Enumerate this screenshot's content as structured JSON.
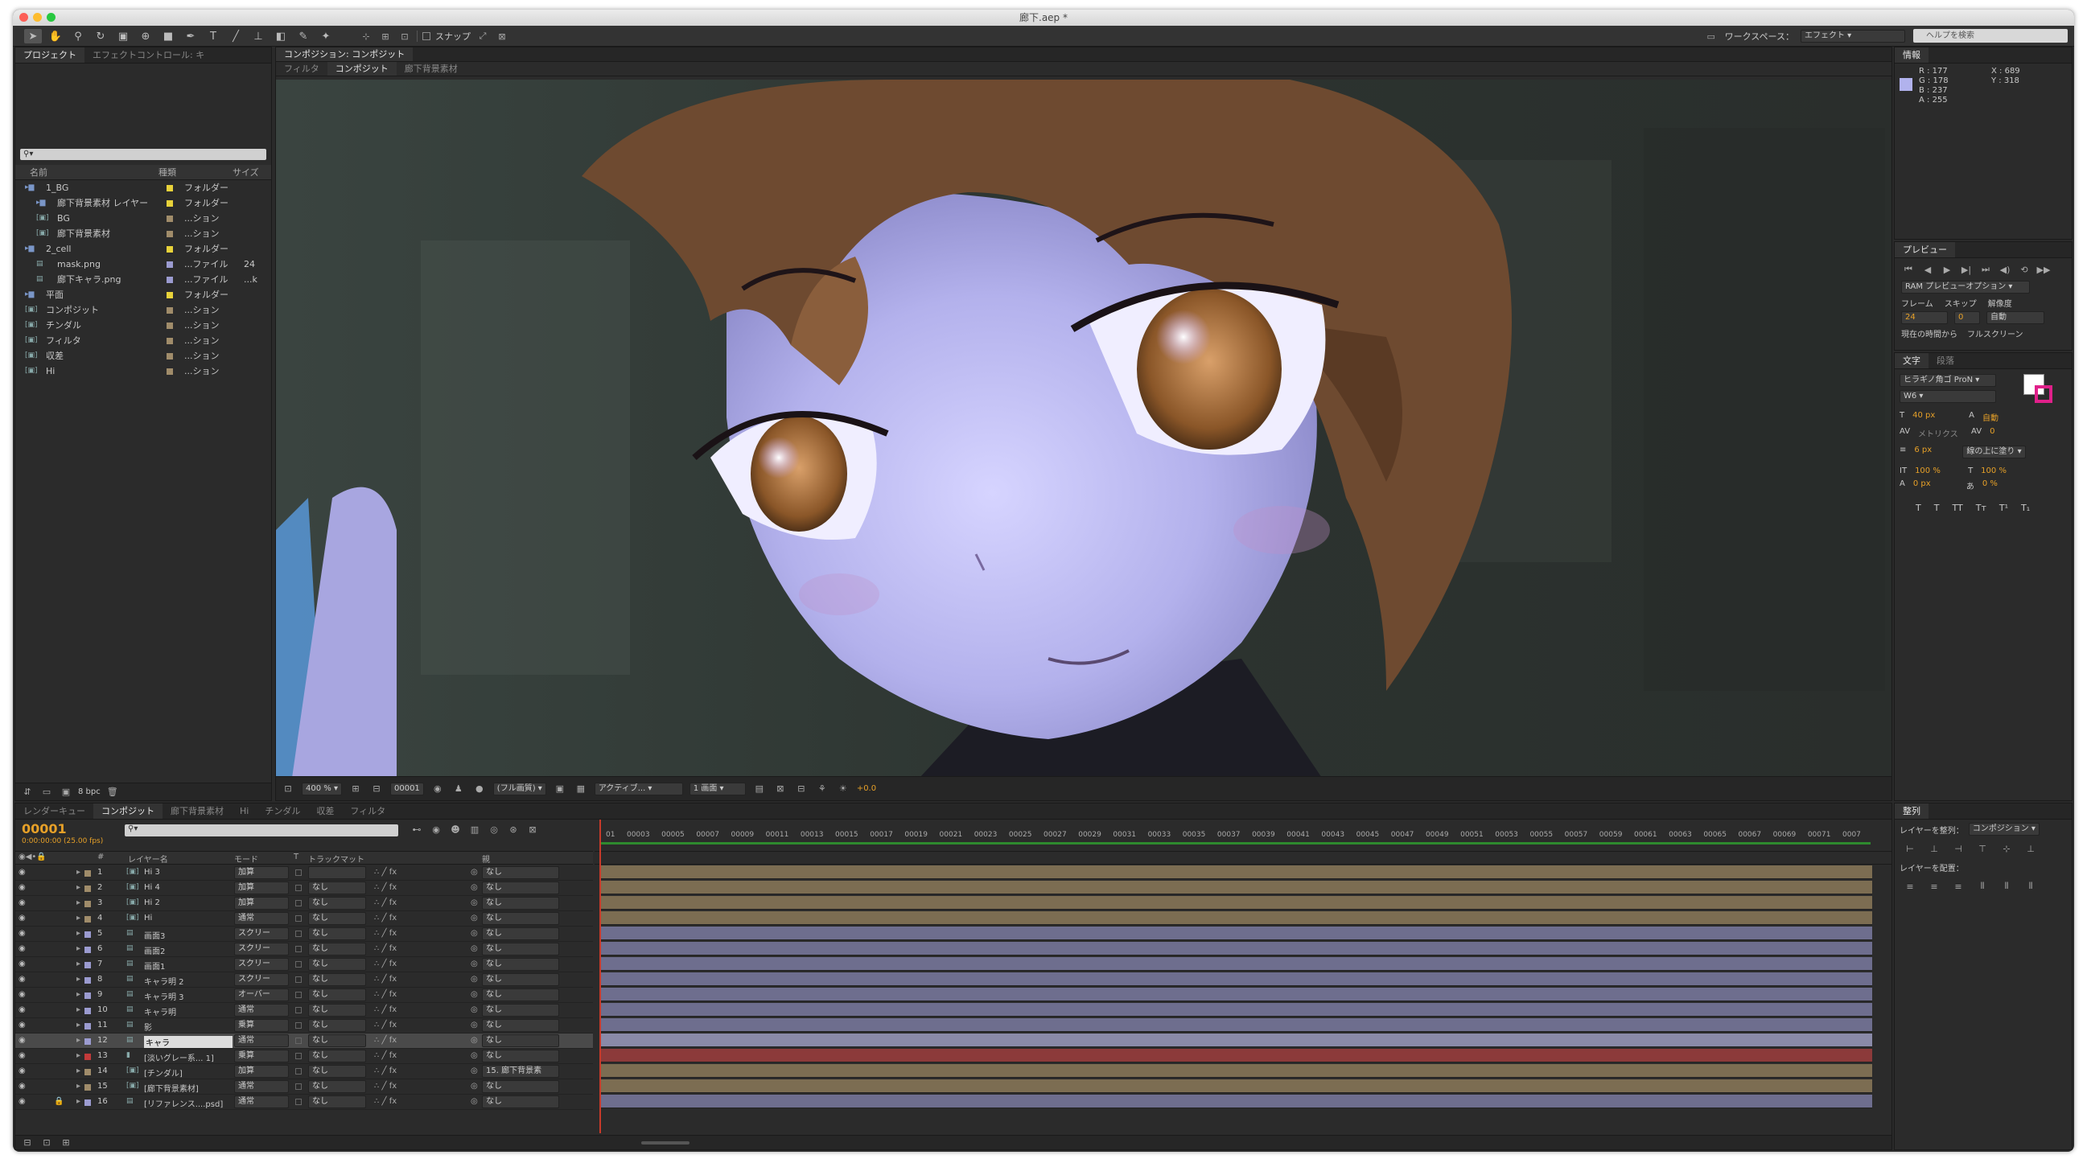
{
  "window": {
    "title": "廊下.aep *"
  },
  "toolbar": {
    "snap_label": "スナップ",
    "workspace_label": "ワークスペース：",
    "workspace_value": "エフェクト",
    "help_placeholder": "ヘルプを検索"
  },
  "project_panel": {
    "tabs": [
      "プロジェクト",
      "エフェクトコントロール: キ"
    ],
    "search_placeholder": "",
    "columns": [
      "名前",
      "種類",
      "サイズ"
    ],
    "items": [
      {
        "name": "1_BG",
        "type": "フォルダー",
        "size": "",
        "indent": 0,
        "kind": "folder",
        "color": "#e8d23a"
      },
      {
        "name": "廊下背景素材 レイヤー",
        "type": "フォルダー",
        "size": "",
        "indent": 1,
        "kind": "folder",
        "color": "#e8d23a"
      },
      {
        "name": "BG",
        "type": "...ション",
        "size": "",
        "indent": 1,
        "kind": "comp",
        "color": "#a08c6a"
      },
      {
        "name": "廊下背景素材",
        "type": "...ション",
        "size": "",
        "indent": 1,
        "kind": "comp",
        "color": "#a08c6a"
      },
      {
        "name": "2_cell",
        "type": "フォルダー",
        "size": "",
        "indent": 0,
        "kind": "folder",
        "color": "#e8d23a"
      },
      {
        "name": "mask.png",
        "type": "...ファイル",
        "size": "24",
        "indent": 1,
        "kind": "file",
        "color": "#9b9bd0"
      },
      {
        "name": "廊下キャラ.png",
        "type": "...ファイル",
        "size": "...k",
        "indent": 1,
        "kind": "file",
        "color": "#9b9bd0"
      },
      {
        "name": "平面",
        "type": "フォルダー",
        "size": "",
        "indent": 0,
        "kind": "folder",
        "color": "#e8d23a"
      },
      {
        "name": "コンポジット",
        "type": "...ション",
        "size": "",
        "indent": 0,
        "kind": "comp",
        "color": "#a08c6a"
      },
      {
        "name": "チンダル",
        "type": "...ション",
        "size": "",
        "indent": 0,
        "kind": "comp",
        "color": "#a08c6a"
      },
      {
        "name": "フィルタ",
        "type": "...ション",
        "size": "",
        "indent": 0,
        "kind": "comp",
        "color": "#a08c6a"
      },
      {
        "name": "収差",
        "type": "...ション",
        "size": "",
        "indent": 0,
        "kind": "comp",
        "color": "#a08c6a"
      },
      {
        "name": "Hi",
        "type": "...ション",
        "size": "",
        "indent": 0,
        "kind": "comp",
        "color": "#a08c6a"
      }
    ],
    "bpc": "8 bpc"
  },
  "comp_panel": {
    "tab": "コンポジション: コンポジット",
    "subtabs": [
      "フィルタ",
      "コンポジット",
      "廊下背景素材"
    ],
    "zoom": "400 %",
    "timecode": "00001",
    "resolution": "(フル画質)",
    "camera": "アクティブ...",
    "views": "1 画面",
    "exposure": "+0.0"
  },
  "info_panel": {
    "title": "情報",
    "r": "R : 177",
    "g": "G : 178",
    "b": "B : 237",
    "a": "A : 255",
    "x": "X : 689",
    "y": "Y : 318",
    "swatch": "#b1b2ed"
  },
  "preview_panel": {
    "title": "プレビュー",
    "ram_label": "RAM プレビューオプション",
    "frame_label": "フレーム",
    "skip_label": "スキップ",
    "res_label": "解像度",
    "frame_value": "24",
    "skip_value": "0",
    "res_value": "自動",
    "from_current": "現在の時間から",
    "fullscreen": "フルスクリーン"
  },
  "char_panel": {
    "tabs": [
      "文字",
      "段落"
    ],
    "font": "ヒラギノ角ゴ ProN",
    "style": "W6",
    "size": "40 px",
    "leading": "自動",
    "kerning": "メトリクス",
    "tracking": "0",
    "stroke": "6 px",
    "stroke_mode": "線の上に塗り",
    "vscale": "100 %",
    "hscale": "100 %",
    "baseline": "0 px",
    "tsume": "0 %",
    "styles": [
      "T",
      "T",
      "TT",
      "Tт",
      "T¹",
      "T₁"
    ]
  },
  "align_panel": {
    "title": "整列",
    "align_to_label": "レイヤーを整列：",
    "align_to_value": "コンポジション",
    "distribute_label": "レイヤーを配置："
  },
  "timeline": {
    "tabs": [
      "レンダーキュー",
      "コンポジット",
      "廊下背景素材",
      "Hi",
      "チンダル",
      "収差",
      "フィルタ"
    ],
    "timecode": "00001",
    "timecode_sub": "0:00:00:00 (25.00 fps)",
    "columns": {
      "num": "#",
      "name": "レイヤー名",
      "mode": "モード",
      "t": "T",
      "trkmat": "トラックマット",
      "parent": "親"
    },
    "ruler": [
      "01",
      "00003",
      "00005",
      "00007",
      "00009",
      "00011",
      "00013",
      "00015",
      "00017",
      "00019",
      "00021",
      "00023",
      "00025",
      "00027",
      "00029",
      "00031",
      "00033",
      "00035",
      "00037",
      "00039",
      "00041",
      "00043",
      "00045",
      "00047",
      "00049",
      "00051",
      "00053",
      "00055",
      "00057",
      "00059",
      "00061",
      "00063",
      "00065",
      "00067",
      "00069",
      "00071",
      "0007"
    ],
    "layers": [
      {
        "num": "1",
        "name": "Hi 3",
        "mode": "加算",
        "trk": "",
        "parent": "なし",
        "color": "#a08c6a",
        "kind": "comp",
        "bar": "#7c6d52"
      },
      {
        "num": "2",
        "name": "Hi 4",
        "mode": "加算",
        "trk": "なし",
        "parent": "なし",
        "color": "#a08c6a",
        "kind": "comp",
        "bar": "#7c6d52"
      },
      {
        "num": "3",
        "name": "Hi 2",
        "mode": "加算",
        "trk": "なし",
        "parent": "なし",
        "color": "#a08c6a",
        "kind": "comp",
        "bar": "#7c6d52"
      },
      {
        "num": "4",
        "name": "Hi",
        "mode": "通常",
        "trk": "なし",
        "parent": "なし",
        "color": "#a08c6a",
        "kind": "comp",
        "bar": "#7c6d52"
      },
      {
        "num": "5",
        "name": "画面3",
        "mode": "スクリー",
        "trk": "なし",
        "parent": "なし",
        "color": "#9b9bd0",
        "kind": "file",
        "bar": "#6e6e8e"
      },
      {
        "num": "6",
        "name": "画面2",
        "mode": "スクリー",
        "trk": "なし",
        "parent": "なし",
        "color": "#9b9bd0",
        "kind": "file",
        "bar": "#6e6e8e"
      },
      {
        "num": "7",
        "name": "画面1",
        "mode": "スクリー",
        "trk": "なし",
        "parent": "なし",
        "color": "#9b9bd0",
        "kind": "file",
        "bar": "#6e6e8e"
      },
      {
        "num": "8",
        "name": "キャラ明 2",
        "mode": "スクリー",
        "trk": "なし",
        "parent": "なし",
        "color": "#9b9bd0",
        "kind": "file",
        "bar": "#6e6e8e"
      },
      {
        "num": "9",
        "name": "キャラ明 3",
        "mode": "オーバー",
        "trk": "なし",
        "parent": "なし",
        "color": "#9b9bd0",
        "kind": "file",
        "bar": "#6e6e8e"
      },
      {
        "num": "10",
        "name": "キャラ明",
        "mode": "通常",
        "trk": "なし",
        "parent": "なし",
        "color": "#9b9bd0",
        "kind": "file",
        "bar": "#6e6e8e"
      },
      {
        "num": "11",
        "name": "影",
        "mode": "乗算",
        "trk": "なし",
        "parent": "なし",
        "color": "#9b9bd0",
        "kind": "file",
        "bar": "#6e6e8e"
      },
      {
        "num": "12",
        "name": "キャラ",
        "mode": "通常",
        "trk": "なし",
        "parent": "なし",
        "color": "#9b9bd0",
        "kind": "file",
        "bar": "#8a8aa8",
        "selected": true
      },
      {
        "num": "13",
        "name": "[淡いグレー系... 1]",
        "mode": "乗算",
        "trk": "なし",
        "parent": "なし",
        "color": "#c23a3a",
        "kind": "solid",
        "bar": "#8c3a3a"
      },
      {
        "num": "14",
        "name": "[チンダル]",
        "mode": "加算",
        "trk": "なし",
        "parent": "15. 廊下背景素",
        "color": "#a08c6a",
        "kind": "comp",
        "bar": "#7c6d52"
      },
      {
        "num": "15",
        "name": "[廊下背景素材]",
        "mode": "通常",
        "trk": "なし",
        "parent": "なし",
        "color": "#a08c6a",
        "kind": "comp",
        "bar": "#7c6d52"
      },
      {
        "num": "16",
        "name": "[リファレンス....psd]",
        "mode": "通常",
        "trk": "なし",
        "parent": "なし",
        "color": "#9b9bd0",
        "kind": "file",
        "bar": "#6e6e8e"
      }
    ]
  }
}
